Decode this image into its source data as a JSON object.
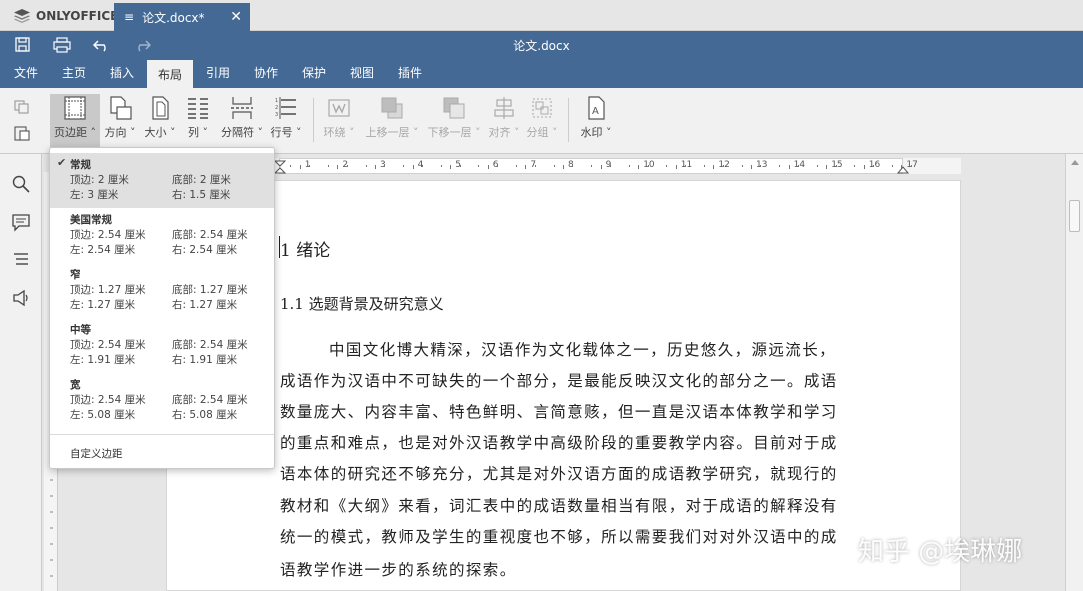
{
  "brand": {
    "name": "ONLYOFFICE"
  },
  "tab": {
    "label": "论文.docx*"
  },
  "title": "论文.docx",
  "menu": [
    "文件",
    "主页",
    "插入",
    "布局",
    "引用",
    "协作",
    "保护",
    "视图",
    "插件"
  ],
  "menu_active": "布局",
  "toolbar": {
    "margins": "页边距",
    "orientation": "方向",
    "size": "大小",
    "columns": "列",
    "breaks": "分隔符",
    "line_numbers": "行号",
    "wrap": "环绕",
    "bring_forward": "上移一层",
    "send_backward": "下移一层",
    "align": "对齐",
    "group": "分组",
    "watermark": "水印"
  },
  "margins_menu": {
    "options": [
      {
        "name": "常规",
        "top": "顶边:   2 厘米",
        "bottom": "底部:   2 厘米",
        "left": "左:   3 厘米",
        "right": "右:   1.5 厘米",
        "selected": true
      },
      {
        "name": "美国常规",
        "top": "顶边:   2.54 厘米",
        "bottom": "底部:   2.54 厘米",
        "left": "左:   2.54 厘米",
        "right": "右:   2.54 厘米",
        "selected": false
      },
      {
        "name": "窄",
        "top": "顶边:   1.27 厘米",
        "bottom": "底部:   1.27 厘米",
        "left": "左:   1.27 厘米",
        "right": "右:   1.27 厘米",
        "selected": false
      },
      {
        "name": "中等",
        "top": "顶边:   2.54 厘米",
        "bottom": "底部:   2.54 厘米",
        "left": "左:   1.91 厘米",
        "right": "右:   1.91 厘米",
        "selected": false
      },
      {
        "name": "宽",
        "top": "顶边:   2.54 厘米",
        "bottom": "底部:   2.54 厘米",
        "left": "左:   5.08 厘米",
        "right": "右:   5.08 厘米",
        "selected": false
      }
    ],
    "custom": "自定义边距"
  },
  "document": {
    "heading1": "1 绪论",
    "heading2": "1.1 选题背景及研究意义",
    "paragraph_lines": [
      "中国文化博大精深，汉语作为文化载体之一，历史悠久，源远流长，",
      "成语作为汉语中不可缺失的一个部分，是最能反映汉文化的部分之一。成语",
      "数量庞大、内容丰富、特色鲜明、言简意赅，但一直是汉语本体教学和学习",
      "的重点和难点，也是对外汉语教学中高级阶段的重要教学内容。目前对于成",
      "语本体的研究还不够充分，尤其是对外汉语方面的成语教学研究，就现行的",
      "教材和《大纲》来看，词汇表中的成语数量相当有限，对于成语的解释没有",
      "统一的模式，教师及学生的重视度也不够，所以需要我们对对外汉语中的成",
      "语教学作进一步的系统的探索。"
    ]
  },
  "ruler": {
    "numbers": [
      "1",
      "2",
      "3",
      "4",
      "5",
      "6",
      "7",
      "8",
      "9",
      "10",
      "11",
      "12",
      "13",
      "14",
      "15",
      "16",
      "17"
    ]
  },
  "watermark_text": "知乎 @埃琳娜",
  "colors": {
    "accent": "#446995",
    "toolbar_bg": "#f1f1f1",
    "canvas_bg": "#e6e6e6"
  }
}
